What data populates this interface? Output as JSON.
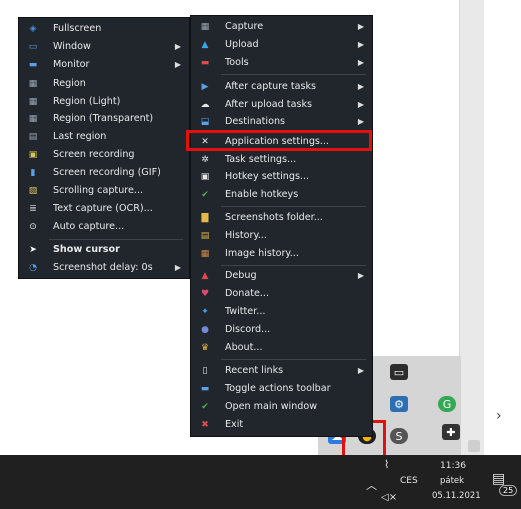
{
  "submenu_capture": {
    "items": [
      {
        "label": "Fullscreen",
        "icon": "fullscreen-icon",
        "color": "#4a90d9",
        "has_sub": false
      },
      {
        "label": "Window",
        "icon": "window-icon",
        "color": "#5aa0e8",
        "has_sub": true
      },
      {
        "label": "Monitor",
        "icon": "monitor-icon",
        "color": "#5aa0e8",
        "has_sub": true
      },
      {
        "label": "Region",
        "icon": "region-icon",
        "color": "#9aa7b5",
        "has_sub": false
      },
      {
        "label": "Region (Light)",
        "icon": "region-light-icon",
        "color": "#9aa7b5",
        "has_sub": false
      },
      {
        "label": "Region (Transparent)",
        "icon": "region-transparent-icon",
        "color": "#9aa7b5",
        "has_sub": false
      },
      {
        "label": "Last region",
        "icon": "last-region-icon",
        "color": "#9aa7b5",
        "has_sub": false
      },
      {
        "label": "Screen recording",
        "icon": "screen-recording-icon",
        "color": "#d6c35a",
        "has_sub": false
      },
      {
        "label": "Screen recording (GIF)",
        "icon": "gif-recording-icon",
        "color": "#5aa0e8",
        "has_sub": false
      },
      {
        "label": "Scrolling capture...",
        "icon": "scrolling-capture-icon",
        "color": "#d6c35a",
        "has_sub": false
      },
      {
        "label": "Text capture (OCR)...",
        "icon": "ocr-icon",
        "color": "#cfcfcf",
        "has_sub": false
      },
      {
        "label": "Auto capture...",
        "icon": "auto-capture-icon",
        "color": "#e8e8e8",
        "has_sub": false
      },
      {
        "label": "Show cursor",
        "icon": "cursor-icon",
        "color": "#ffffff",
        "has_sub": false,
        "bold": true
      },
      {
        "label": "Screenshot delay: 0s",
        "icon": "delay-icon",
        "color": "#5aa0e8",
        "has_sub": true
      }
    ]
  },
  "main_menu": {
    "items": [
      {
        "label": "Capture",
        "icon": "capture-icon",
        "color": "#9aa7b5",
        "has_sub": true
      },
      {
        "label": "Upload",
        "icon": "upload-icon",
        "color": "#3aa7e8",
        "has_sub": true
      },
      {
        "label": "Tools",
        "icon": "tools-icon",
        "color": "#e04a4a",
        "has_sub": true
      },
      {
        "label": "After capture tasks",
        "icon": "after-capture-icon",
        "color": "#5aa0e8",
        "has_sub": true
      },
      {
        "label": "After upload tasks",
        "icon": "after-upload-icon",
        "color": "#e8e8e8",
        "has_sub": true
      },
      {
        "label": "Destinations",
        "icon": "destinations-icon",
        "color": "#5aa0e8",
        "has_sub": true
      },
      {
        "label": "Application settings...",
        "icon": "application-settings-icon",
        "color": "#e8e8e8",
        "has_sub": false
      },
      {
        "label": "Task settings...",
        "icon": "task-settings-icon",
        "color": "#e8e8e8",
        "has_sub": false
      },
      {
        "label": "Hotkey settings...",
        "icon": "hotkey-settings-icon",
        "color": "#e8e8e8",
        "has_sub": false
      },
      {
        "label": "Enable hotkeys",
        "icon": "enable-hotkeys-icon",
        "color": "#4caf50",
        "has_sub": false
      },
      {
        "label": "Screenshots folder...",
        "icon": "screenshots-folder-icon",
        "color": "#e5b84a",
        "has_sub": false
      },
      {
        "label": "History...",
        "icon": "history-icon",
        "color": "#e5b84a",
        "has_sub": false
      },
      {
        "label": "Image history...",
        "icon": "image-history-icon",
        "color": "#d08a4a",
        "has_sub": false
      },
      {
        "label": "Debug",
        "icon": "debug-icon",
        "color": "#e04a4a",
        "has_sub": true
      },
      {
        "label": "Donate...",
        "icon": "donate-icon",
        "color": "#e04a6a",
        "has_sub": false
      },
      {
        "label": "Twitter...",
        "icon": "twitter-icon",
        "color": "#3aa7e8",
        "has_sub": false
      },
      {
        "label": "Discord...",
        "icon": "discord-icon",
        "color": "#7289da",
        "has_sub": false
      },
      {
        "label": "About...",
        "icon": "about-icon",
        "color": "#e5b84a",
        "has_sub": false
      },
      {
        "label": "Recent links",
        "icon": "recent-links-icon",
        "color": "#e8e8e8",
        "has_sub": true
      },
      {
        "label": "Toggle actions toolbar",
        "icon": "actions-toolbar-icon",
        "color": "#5aa0e8",
        "has_sub": false
      },
      {
        "label": "Open main window",
        "icon": "open-main-window-icon",
        "color": "#4caf50",
        "has_sub": false
      },
      {
        "label": "Exit",
        "icon": "exit-icon",
        "color": "#e04a4a",
        "has_sub": false
      }
    ]
  },
  "taskbar": {
    "time": "11:36",
    "day": "pátek",
    "date": "05.11.2021",
    "lang": "CES",
    "notifications": "25"
  }
}
